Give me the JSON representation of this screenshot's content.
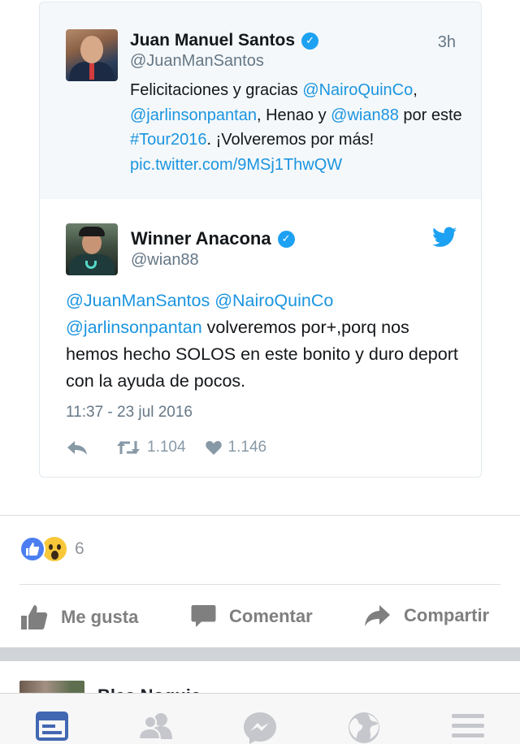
{
  "quoted_tweet": {
    "name": "Juan Manuel Santos",
    "handle": "@JuanManSantos",
    "time": "3h",
    "text_parts": {
      "p1": "Felicitaciones y gracias ",
      "m1": "@NairoQuinCo",
      "p2": ", ",
      "m2": "@jarlinsonpantan",
      "p3": ", Henao y ",
      "m3": "@wian88",
      "p4": " por este ",
      "tag": "#Tour2016",
      "p5": ". ¡Volveremos por más! ",
      "link": "pic.twitter.com/9MSj1ThwQW"
    }
  },
  "main_tweet": {
    "name": "Winner Anacona",
    "handle": "@wian88",
    "text_parts": {
      "m1": "@JuanManSantos",
      "m2": "@NairoQuinCo",
      "m3": "@jarlinsonpantan",
      "rest": " volveremos por+,porq nos hemos hecho SOLOS en este bonito y duro deport con la ayuda de pocos."
    },
    "date": "11:37 - 23 jul 2016",
    "retweets": "1.104",
    "likes": "1.146"
  },
  "reactions": {
    "count": "6"
  },
  "fb_actions": {
    "like": "Me gusta",
    "comment": "Comentar",
    "share": "Compartir"
  },
  "next_post": {
    "name": "Blas Noquic..."
  },
  "icons": [
    "verified-icon",
    "twitter-bird-icon",
    "reply-icon",
    "retweet-icon",
    "heart-icon",
    "like-thumb-icon",
    "comment-icon",
    "share-icon",
    "news-feed-icon",
    "friends-icon",
    "messenger-icon",
    "globe-icon",
    "menu-icon"
  ],
  "colors": {
    "twitter_blue": "#1b95e0",
    "fb_blue": "#4c7ef2",
    "tab_active": "#4267b2",
    "tab_inactive": "#c5c7cc"
  }
}
